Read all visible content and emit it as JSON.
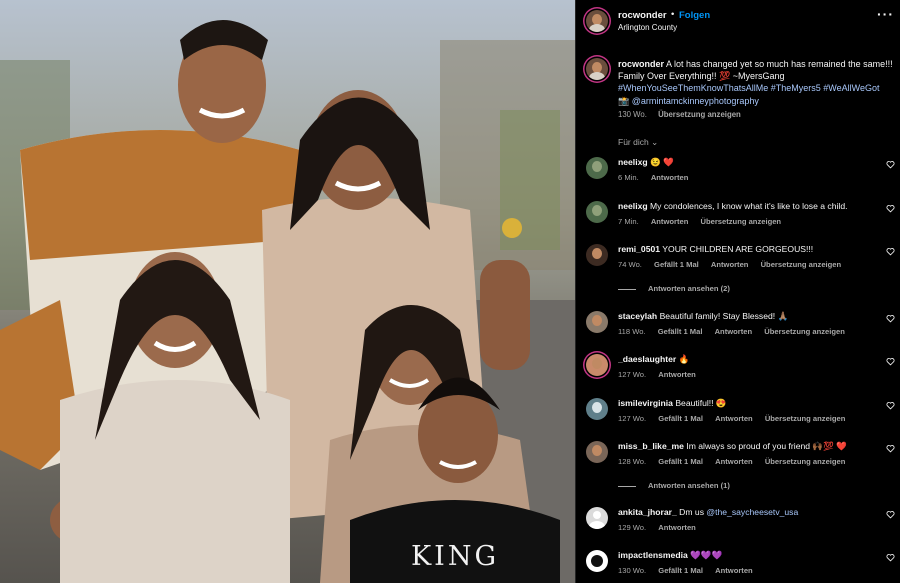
{
  "post": {
    "author": "rocwonder",
    "dot": "•",
    "follow_label": "Folgen",
    "location": "Arlington County",
    "more_icon": "more-horizontal-icon"
  },
  "caption": {
    "user": "rocwonder",
    "text": "A lot has changed yet so much has remained the same!!! Family Over Everything!! 💯 ~MyersGang",
    "hashtags": "#WhenYouSeeThemKnowThatsAllMe #TheMyers5 #WeAllWeGot",
    "credit": "📸 @armintamckinneyphotography",
    "time": "130 Wo.",
    "translate": "Übersetzung anzeigen"
  },
  "sort_label": "Für dich ⌄",
  "comments": [
    {
      "user": "neelixg",
      "text": "😉 ❤️",
      "time": "6 Min.",
      "likes": "",
      "reply": "Antworten",
      "translate": ""
    },
    {
      "user": "neelixg",
      "text": "My condolences, I know what it's like to lose a child.",
      "time": "7 Min.",
      "likes": "",
      "reply": "Antworten",
      "translate": "Übersetzung anzeigen"
    },
    {
      "user": "remi_0501",
      "text": "YOUR CHILDREN ARE GORGEOUS!!!",
      "time": "74 Wo.",
      "likes": "Gefällt 1 Mal",
      "reply": "Antworten",
      "translate": "Übersetzung anzeigen"
    },
    {
      "user": "staceylah",
      "text": "Beautiful family! Stay Blessed! 🙏🏽",
      "time": "118 Wo.",
      "likes": "Gefällt 1 Mal",
      "reply": "Antworten",
      "translate": "Übersetzung anzeigen"
    },
    {
      "user": "_daeslaughter",
      "text": "🔥",
      "time": "127 Wo.",
      "likes": "",
      "reply": "Antworten",
      "translate": ""
    },
    {
      "user": "ismilevirginia",
      "text": "Beautiful!! 😍",
      "time": "127 Wo.",
      "likes": "Gefällt 1 Mal",
      "reply": "Antworten",
      "translate": "Übersetzung anzeigen"
    },
    {
      "user": "miss_b_like_me",
      "text": "Im always so proud of you friend 🙌🏾💯 ❤️",
      "time": "128 Wo.",
      "likes": "Gefällt 1 Mal",
      "reply": "Antworten",
      "translate": "Übersetzung anzeigen"
    },
    {
      "user": "ankita_jhorar_",
      "text": "Dm us",
      "mention": "@the_saycheesetv_usa",
      "time": "129 Wo.",
      "likes": "",
      "reply": "Antworten",
      "translate": ""
    },
    {
      "user": "impactlensmedia",
      "text": "💜💜💜",
      "time": "130 Wo.",
      "likes": "Gefällt 1 Mal",
      "reply": "Antworten",
      "translate": ""
    }
  ],
  "view_replies": [
    "Antworten ansehen (2)",
    "Antworten ansehen (1)"
  ],
  "photo": {
    "shirt_text": "KING"
  },
  "colors": {
    "background": "#000000",
    "link": "#0095f6",
    "hashtag": "#a8c7fa",
    "muted": "#a8a8a8"
  }
}
